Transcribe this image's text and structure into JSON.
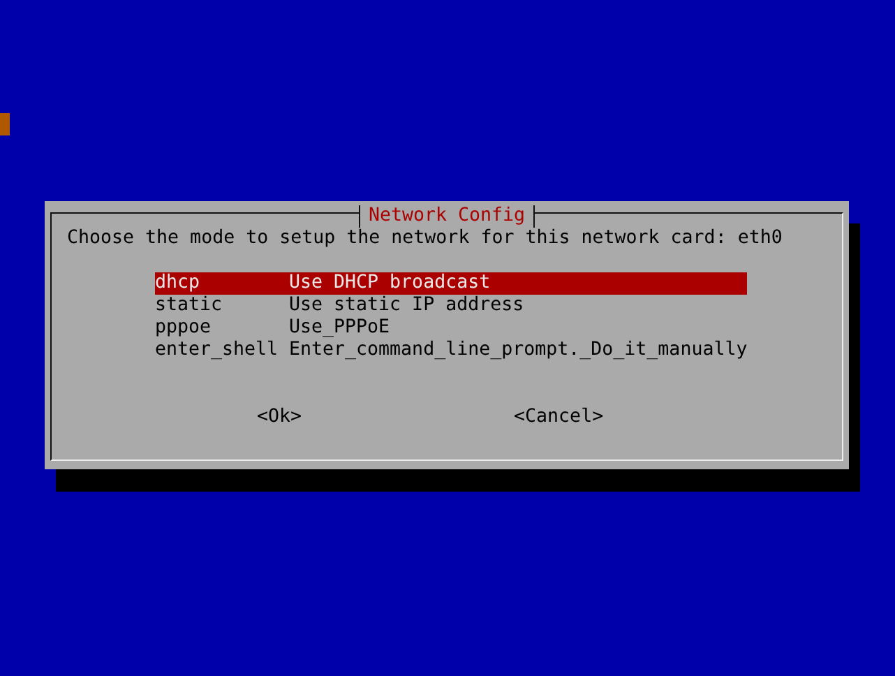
{
  "dialog": {
    "title": "Network Config",
    "message": "Choose the mode to setup the network for this network card: eth0",
    "items": [
      {
        "tag": "dhcp",
        "description": "Use DHCP broadcast",
        "selected": true
      },
      {
        "tag": "static",
        "description": "Use static IP address",
        "selected": false
      },
      {
        "tag": "pppoe",
        "description": "Use_PPPoE",
        "selected": false
      },
      {
        "tag": "enter_shell",
        "description": "Enter_command_line_prompt._Do_it_manually",
        "selected": false
      }
    ],
    "buttons": [
      "<Ok>",
      "<Cancel>"
    ]
  }
}
